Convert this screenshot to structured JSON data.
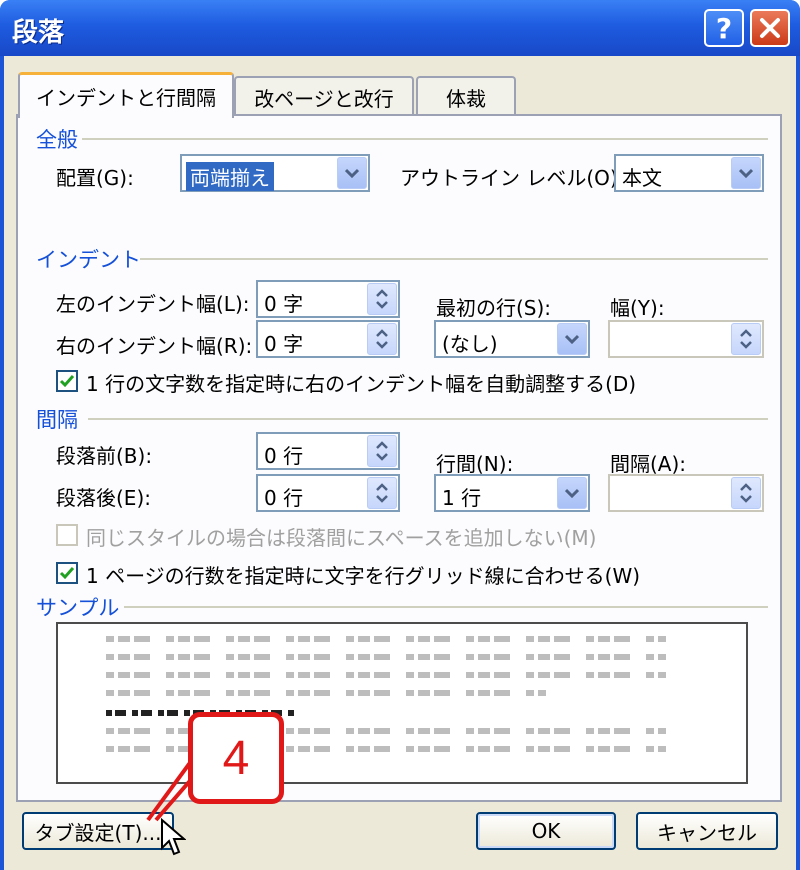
{
  "window": {
    "title": "段落"
  },
  "titlebar_buttons": {
    "help": "?",
    "close": "X"
  },
  "tabs": [
    "インデントと行間隔",
    "改ページと改行",
    "体裁"
  ],
  "general": {
    "heading": "全般",
    "alignment_label": "配置(G):",
    "alignment_value": "両端揃え",
    "outline_label": "アウトライン レベル(O):",
    "outline_value": "本文"
  },
  "indent": {
    "heading": "インデント",
    "left_label": "左のインデント幅(L):",
    "left_value": "0 字",
    "right_label": "右のインデント幅(R):",
    "right_value": "0 字",
    "first_line_label": "最初の行(S):",
    "first_line_value": "(なし)",
    "width_label": "幅(Y):",
    "width_value": "",
    "auto_adjust_label": "1 行の文字数を指定時に右のインデント幅を自動調整する(D)",
    "auto_adjust_checked": true
  },
  "spacing": {
    "heading": "間隔",
    "before_label": "段落前(B):",
    "before_value": "0 行",
    "after_label": "段落後(E):",
    "after_value": "0 行",
    "line_spacing_label": "行間(N):",
    "line_spacing_value": "1 行",
    "at_label": "間隔(A):",
    "at_value": "",
    "no_space_same_style_label": "同じスタイルの場合は段落間にスペースを追加しない(M)",
    "no_space_same_style_checked": false,
    "snap_to_grid_label": "1 ページの行数を指定時に文字を行グリッド線に合わせる(W)",
    "snap_to_grid_checked": true
  },
  "preview": {
    "heading": "サンプル"
  },
  "buttons": {
    "tabs": "タブ設定(T)...",
    "ok": "OK",
    "cancel": "キャンセル"
  },
  "annotation": {
    "step_number": "4"
  },
  "colors": {
    "accent": "#1450d8",
    "titlebar": "#1e5ce0",
    "callout": "#e01818"
  }
}
